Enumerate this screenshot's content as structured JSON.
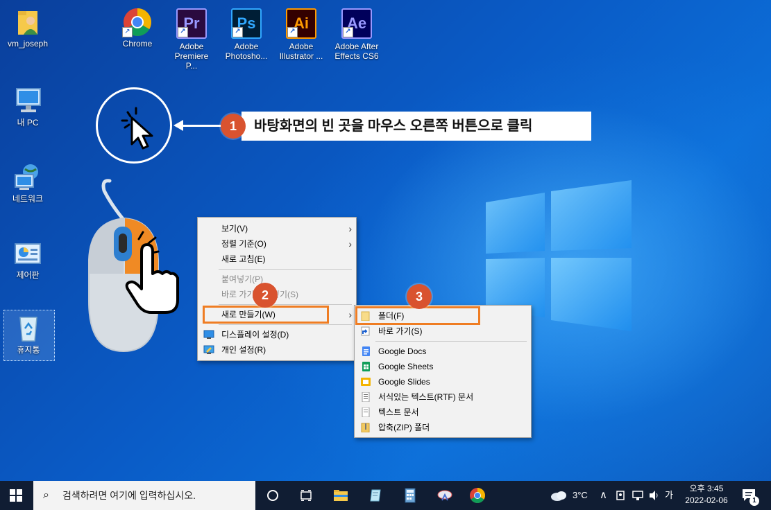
{
  "desktop_icons": {
    "user": "vm_joseph",
    "chrome": "Chrome",
    "premiere": "Adobe Premiere P...",
    "photoshop": "Adobe Photosho...",
    "illustrator": "Adobe Illustrator ...",
    "aftereffects": "Adobe After Effects CS6",
    "mypc": "내 PC",
    "network": "네트워크",
    "control_panel": "제어판",
    "recycle_bin": "휴지통"
  },
  "app_glyphs": {
    "pr": "Pr",
    "ps": "Ps",
    "ai": "Ai",
    "ae": "Ae"
  },
  "tutorial": {
    "step1_number": "1",
    "step1_text": "바탕화면의 빈 곳을 마우스 오른쪽 버튼으로 클릭",
    "step2_number": "2",
    "step3_number": "3"
  },
  "context_menu": {
    "view": "보기(V)",
    "sort": "정렬 기준(O)",
    "refresh": "새로 고침(E)",
    "paste": "붙여넣기(P)",
    "paste_shortcut": "바로 가기 붙여넣기(S)",
    "new": "새로 만들기(W)",
    "display": "디스플레이 설정(D)",
    "personalize": "개인 설정(R)"
  },
  "new_submenu": {
    "folder": "폴더(F)",
    "shortcut": "바로 가기(S)",
    "google_docs": "Google Docs",
    "google_sheets": "Google Sheets",
    "google_slides": "Google Slides",
    "rtf": "서식있는 텍스트(RTF) 문서",
    "text": "텍스트 문서",
    "zip": "압축(ZIP) 폴더"
  },
  "taskbar": {
    "search_placeholder": "검색하려면 여기에 입력하십시오.",
    "weather": "3°C",
    "ime": "가",
    "time": "오후 3:45",
    "date": "2022-02-06",
    "notification_count": "1"
  },
  "colors": {
    "accent_orange": "#ef7d23",
    "badge_red": "#d9532f",
    "taskbar_bg": "#101d33",
    "premiere": "#9999ff",
    "photoshop": "#31a8ff",
    "illustrator": "#ff9a00",
    "aftereffects": "#9999ff"
  }
}
